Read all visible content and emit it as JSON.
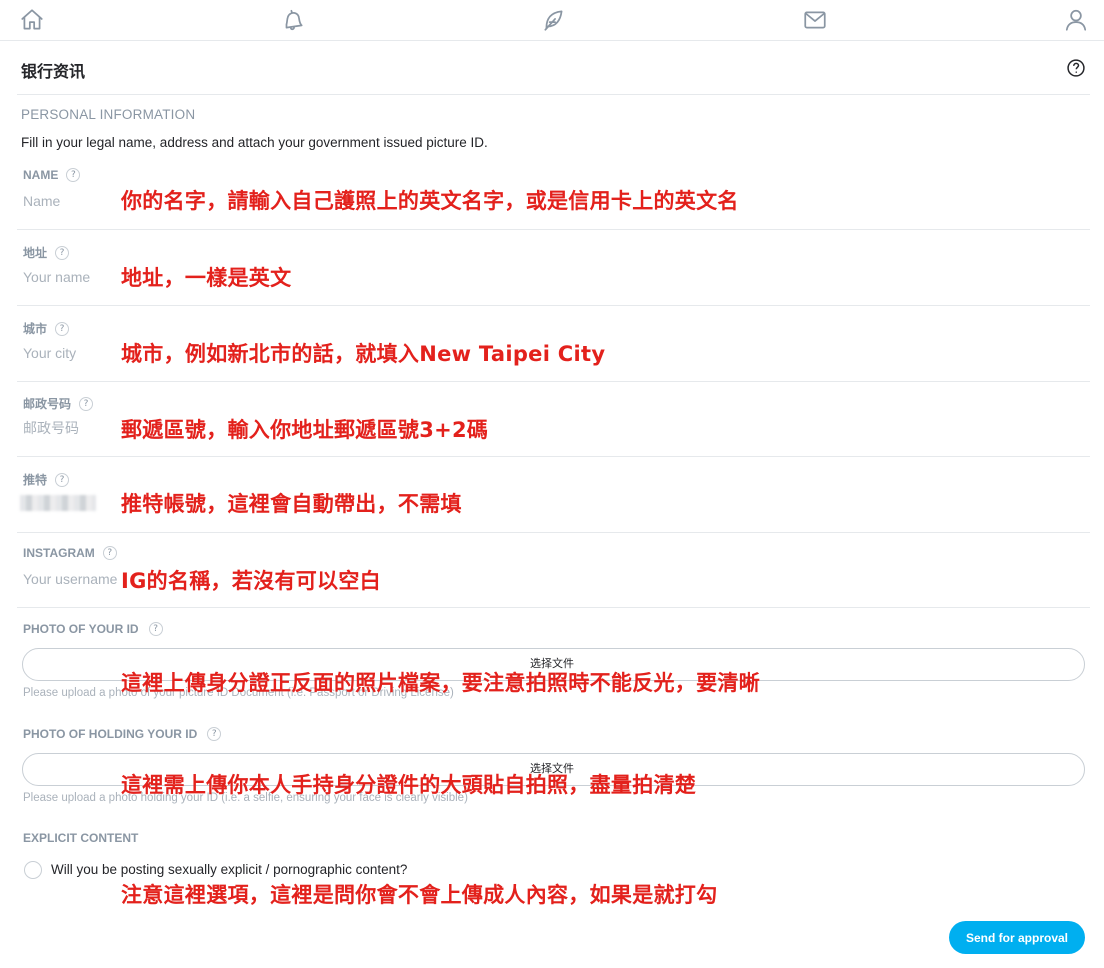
{
  "page": {
    "title": "银行资讯"
  },
  "personal": {
    "section_title": "PERSONAL INFORMATION",
    "description": "Fill in your legal name, address and attach your government issued picture ID."
  },
  "fields": [
    {
      "label": "NAME",
      "placeholder": "Name",
      "annotation": "你的名字，請輸入自己護照上的英文名字，或是信用卡上的英文名"
    },
    {
      "label": "地址",
      "placeholder": "Your name",
      "annotation": "地址，一樣是英文"
    },
    {
      "label": "城市",
      "placeholder": "Your city",
      "annotation": "城市，例如新北市的話，就填入New Taipei City"
    },
    {
      "label": "邮政号码",
      "placeholder": "邮政号码",
      "annotation": "郵遞區號，輸入你地址郵遞區號3+2碼"
    },
    {
      "label": "推特",
      "annotation": "推特帳號，這裡會自動帶出，不需填"
    },
    {
      "label": "INSTAGRAM",
      "placeholder": "Your username",
      "annotation": "IG的名稱，若沒有可以空白"
    }
  ],
  "uploads": [
    {
      "label": "PHOTO OF YOUR ID",
      "button": "选择文件",
      "hint": "Please upload a photo of your picture ID Document (i.e. Passport or Driving License)",
      "annotation": "這裡上傳身分證正反面的照片檔案，要注意拍照時不能反光，要清晰"
    },
    {
      "label": "PHOTO OF HOLDING YOUR ID",
      "button": "选择文件",
      "hint": "Please upload a photo holding your ID (i.e. a selfie, ensuring your face is clearly visible)",
      "annotation": "這裡需上傳你本人手持身分證件的大頭貼自拍照，盡量拍清楚"
    }
  ],
  "explicit": {
    "title": "EXPLICIT CONTENT",
    "question": "Will you be posting sexually explicit / pornographic content?",
    "annotation": "注意這裡選項，這裡是問你會不會上傳成人內容，如果是就打勾"
  },
  "actions": {
    "send_label": "Send for approval"
  },
  "help_glyph": "?",
  "colors": {
    "accent": "#00aff0",
    "annotation": "#e3211c",
    "muted": "#8a96a3",
    "text": "#242529"
  },
  "icons": [
    "home-icon",
    "bell-icon",
    "feather-icon",
    "mail-icon",
    "user-icon",
    "help-icon"
  ]
}
